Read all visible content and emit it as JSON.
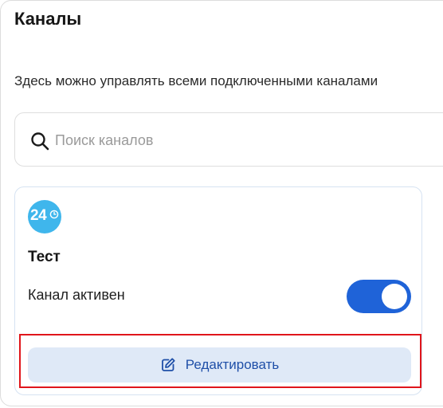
{
  "page": {
    "title": "Каналы",
    "subtitle": "Здесь можно управлять всеми подключенными каналами"
  },
  "search": {
    "placeholder": "Поиск каналов",
    "value": "",
    "icon": "search-icon"
  },
  "channel": {
    "logo_text": "24",
    "logo_icon": "clock-icon",
    "logo_color": "#3fb6ec",
    "name": "Тест",
    "status_label": "Канал активен",
    "active": true,
    "toggle_color": "#1f63d8"
  },
  "actions": {
    "edit_label": "Редактировать",
    "edit_icon": "pencil-icon",
    "edit_color": "#1f4fa8"
  },
  "annotation": {
    "highlight_color": "#e0151b"
  }
}
